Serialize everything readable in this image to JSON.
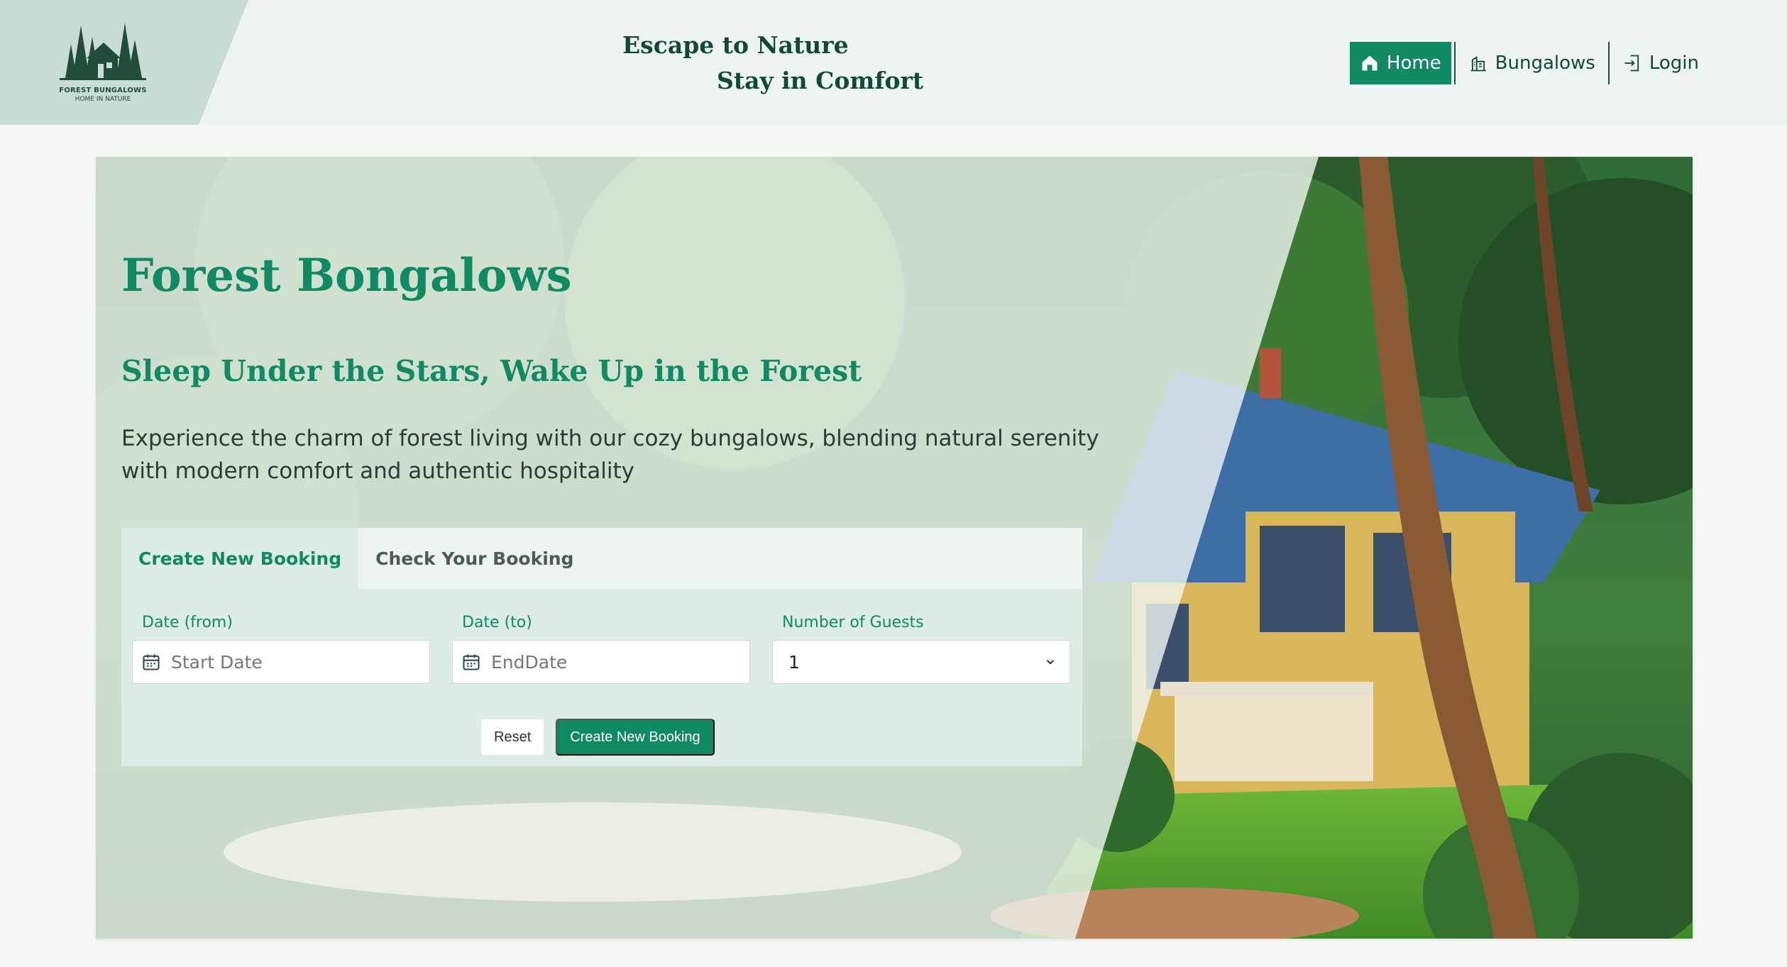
{
  "brand": {
    "logo_title": "FOREST BUNGALOWS",
    "logo_subtitle": "HOME IN NATURE"
  },
  "header": {
    "tagline_line1": "Escape to Nature",
    "tagline_line2": "Stay in Comfort"
  },
  "nav": {
    "items": [
      {
        "label": "Home",
        "icon": "home-icon",
        "active": true
      },
      {
        "label": "Bungalows",
        "icon": "building-icon",
        "active": false
      },
      {
        "label": "Login",
        "icon": "login-icon",
        "active": false
      }
    ]
  },
  "hero": {
    "title": "Forest Bongalows",
    "subtitle": "Sleep Under the Stars, Wake Up in the Forest",
    "description": "Experience the charm of forest living with our cozy bungalows, blending natural serenity with modern comfort and authentic hospitality"
  },
  "booking": {
    "tabs": [
      {
        "label": "Create New Booking",
        "active": true
      },
      {
        "label": "Check Your Booking",
        "active": false
      }
    ],
    "fields": {
      "date_from": {
        "label": "Date (from)",
        "placeholder": "Start Date"
      },
      "date_to": {
        "label": "Date (to)",
        "placeholder": "EndDate"
      },
      "guests": {
        "label": "Number of Guests",
        "value": "1"
      }
    },
    "buttons": {
      "reset": "Reset",
      "create": "Create New Booking"
    }
  },
  "colors": {
    "accent": "#108a63",
    "dark_green": "#114a34",
    "header_bg": "#eef4f1",
    "form_bg": "#dbede5"
  }
}
